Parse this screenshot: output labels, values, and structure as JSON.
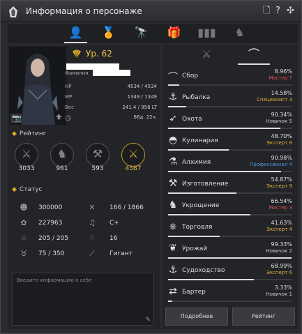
{
  "window": {
    "title": "Информация о персонаже"
  },
  "tabs": [
    {
      "icon": "person-icon",
      "active": true
    },
    {
      "icon": "medal-icon",
      "active": false
    },
    {
      "icon": "telescope-icon",
      "active": false
    },
    {
      "icon": "gift-icon",
      "active": false
    },
    {
      "icon": "bar-chart-icon",
      "active": false
    },
    {
      "icon": "horse-icon",
      "active": false
    }
  ],
  "profile": {
    "level": "Ур. 62",
    "family_label": "Фамилия",
    "stats": [
      {
        "label": "HP",
        "value": "4534 / 4534"
      },
      {
        "label": "MP",
        "value": "1349 / 1349"
      },
      {
        "label": "Вес",
        "value": "241.4 / 958 LT"
      },
      {
        "label": "",
        "value": "66д. 22ч."
      }
    ]
  },
  "rating": {
    "title": "Рейтинг",
    "items": [
      {
        "icon": "crossed-swords-icon",
        "value": "3033",
        "gold": false
      },
      {
        "icon": "horse-head-icon",
        "value": "961",
        "gold": false
      },
      {
        "icon": "hammer-icon",
        "value": "593",
        "gold": false
      },
      {
        "icon": "golden-crossed-swords-icon",
        "value": "4587",
        "gold": true
      }
    ]
  },
  "status": {
    "title": "Статус",
    "items": [
      {
        "icon": "energy-icon",
        "value": "300000"
      },
      {
        "icon": "tools-icon",
        "value": "166 / 1866"
      },
      {
        "icon": "contribution-icon",
        "value": "227963"
      },
      {
        "icon": "music-icon",
        "value": "C+"
      },
      {
        "icon": "bag-icon",
        "value": "205 / 205"
      },
      {
        "icon": "drop-icon",
        "value": "16"
      },
      {
        "icon": "horn-icon",
        "value": "75 / 350"
      },
      {
        "icon": "ruler-icon",
        "value": "Гигант"
      }
    ]
  },
  "about": {
    "placeholder": "Введите информацию о себе"
  },
  "life_skills": [
    {
      "icon": "gathering-icon",
      "name": "Сбор",
      "percent": "8.96%",
      "rank": "Мастер 7",
      "rank_color": "#e05050",
      "progress": 0.0896
    },
    {
      "icon": "fishing-icon",
      "name": "Рыбалка",
      "percent": "14.58%",
      "rank": "Специалист 3",
      "rank_color": "#e0b040",
      "progress": 0.1458
    },
    {
      "icon": "hunting-icon",
      "name": "Охота",
      "percent": "90.34%",
      "rank": "Новичок 5",
      "rank_color": "#cccccc",
      "progress": 0.9034
    },
    {
      "icon": "cooking-icon",
      "name": "Кулинария",
      "percent": "48.70%",
      "rank": "Эксперт 8",
      "rank_color": "#e0b040",
      "progress": 0.487
    },
    {
      "icon": "alchemy-icon",
      "name": "Алхимия",
      "percent": "90.98%",
      "rank": "Профессионал 4",
      "rank_color": "#4a9ae0",
      "progress": 0.9098
    },
    {
      "icon": "processing-icon",
      "name": "Изготовление",
      "percent": "54.87%",
      "rank": "Эксперт 9",
      "rank_color": "#e0b040",
      "progress": 0.5487
    },
    {
      "icon": "training-icon",
      "name": "Укрощение",
      "percent": "66.54%",
      "rank": "Мастер 3",
      "rank_color": "#e05050",
      "progress": 0.6654
    },
    {
      "icon": "trading-icon",
      "name": "Торговля",
      "percent": "41.63%",
      "rank": "Эксперт 4",
      "rank_color": "#e0b040",
      "progress": 0.4163
    },
    {
      "icon": "farming-icon",
      "name": "Урожай",
      "percent": "99.33%",
      "rank": "Новичок 2",
      "rank_color": "#cccccc",
      "progress": 0.9933
    },
    {
      "icon": "sailing-icon",
      "name": "Судоходство",
      "percent": "68.99%",
      "rank": "Эксперт 6",
      "rank_color": "#e0b040",
      "progress": 0.6899
    },
    {
      "icon": "barter-icon",
      "name": "Бартер",
      "percent": "3.33%",
      "rank": "Новичок 1",
      "rank_color": "#cccccc",
      "progress": 0.0333
    }
  ],
  "buttons": {
    "details": "Подробнее",
    "ranking": "Рейтинг"
  }
}
